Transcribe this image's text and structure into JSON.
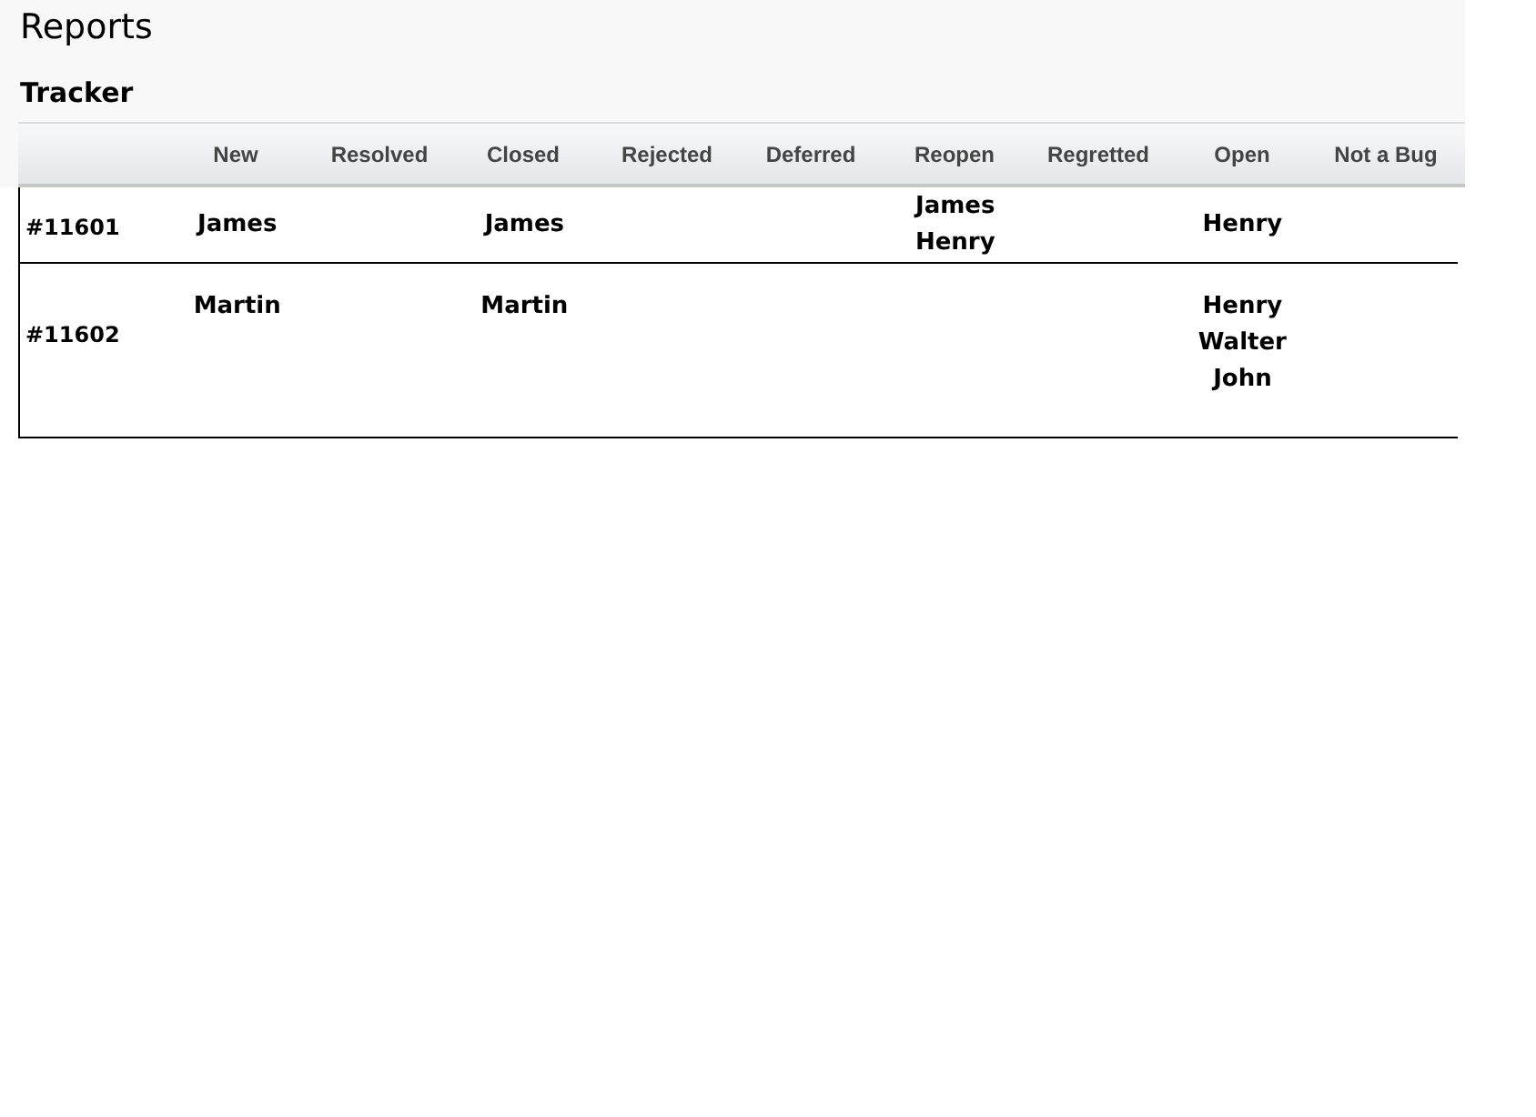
{
  "page": {
    "title": "Reports",
    "subtitle": "Tracker"
  },
  "table": {
    "columns": [
      "New",
      "Resolved",
      "Closed",
      "Rejected",
      "Deferred",
      "Reopen",
      "Regretted",
      "Open",
      "Not a Bug"
    ],
    "rows": [
      {
        "id": "#11601",
        "cells": [
          [
            "James"
          ],
          [],
          [
            "James"
          ],
          [],
          [],
          [
            "James",
            "Henry"
          ],
          [],
          [
            "Henry"
          ],
          []
        ]
      },
      {
        "id": "#11602",
        "cells": [
          [
            "Martin"
          ],
          [],
          [
            "Martin"
          ],
          [],
          [],
          [],
          [],
          [
            "Henry",
            "Walter",
            "John"
          ],
          []
        ]
      }
    ]
  }
}
